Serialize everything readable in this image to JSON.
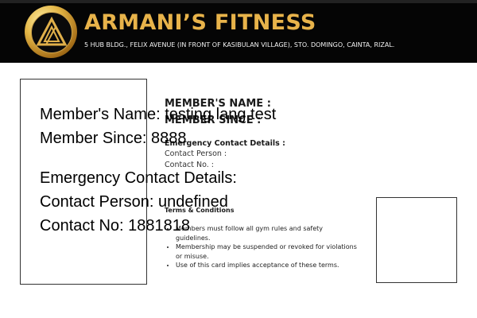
{
  "header": {
    "title": "ARMANI’S FITNESS",
    "address": "5 HUB BLDG., FELIX AVENUE (IN FRONT OF KASIBULAN VILLAGE), STO. DOMINGO, CAINTA, RIZAL."
  },
  "card_labels": {
    "member_name": "MEMBER'S NAME :",
    "member_since": "MEMBER SINCE :",
    "emergency": "Emergency Contact Details :",
    "contact_person": "Contact Person :",
    "contact_no": "Contact No.  :"
  },
  "terms": {
    "title": "Terms & Conditions",
    "items": [
      "Members must follow all gym rules and safety guidelines.",
      "Membership may be suspended or revoked for violations or misuse.",
      "Use of this card implies acceptance of these terms."
    ]
  },
  "member": {
    "name_line": "Member's Name: testing lang test",
    "since_line": "Member Since: 8888",
    "emergency_line": "Emergency Contact Details:",
    "contact_person_line": "Contact Person: undefined",
    "contact_no_line": "Contact No: 1881818"
  },
  "colors": {
    "header_bg": "#050505",
    "brand_gold": "#e8b34a"
  },
  "icons": {
    "logo": "armanis-fitness-logo"
  }
}
